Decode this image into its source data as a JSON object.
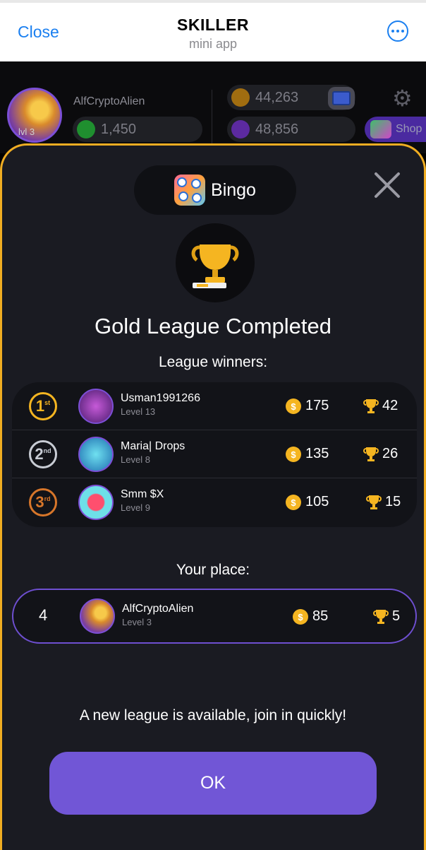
{
  "telegram": {
    "close_label": "Close",
    "title": "SKILLER",
    "subtitle": "mini app"
  },
  "game_header": {
    "username": "AlfCryptoAlien",
    "level": "lvl 3",
    "green_balance": "1,450",
    "gold_balance": "44,263",
    "purple_balance": "48,856",
    "shop_label": "Shop"
  },
  "modal": {
    "game_name": "Bingo",
    "title": "Gold League Completed",
    "winners_label": "League winners:",
    "winners": [
      {
        "rank": "1",
        "suffix": "st",
        "name": "Usman1991266",
        "level": "Level 13",
        "coins": "175",
        "trophies": "42",
        "rank_color": "#f5b521"
      },
      {
        "rank": "2",
        "suffix": "nd",
        "name": "Maria| Drops",
        "level": "Level 8",
        "coins": "135",
        "trophies": "26",
        "rank_color": "#c8ccd4"
      },
      {
        "rank": "3",
        "suffix": "rd",
        "name": "Smm $X",
        "level": "Level 9",
        "coins": "105",
        "trophies": "15",
        "rank_color": "#d7762a"
      }
    ],
    "your_place_label": "Your place:",
    "your_place": {
      "rank": "4",
      "name": "AlfCryptoAlien",
      "level": "Level 3",
      "coins": "85",
      "trophies": "5"
    },
    "notice": "A new league is available, join in quickly!",
    "ok_label": "OK"
  },
  "colors": {
    "accent_blue": "#1a7ff0",
    "modal_border": "#f0ad22",
    "button_purple": "#7156d6",
    "coin_gold": "#f5b521"
  }
}
